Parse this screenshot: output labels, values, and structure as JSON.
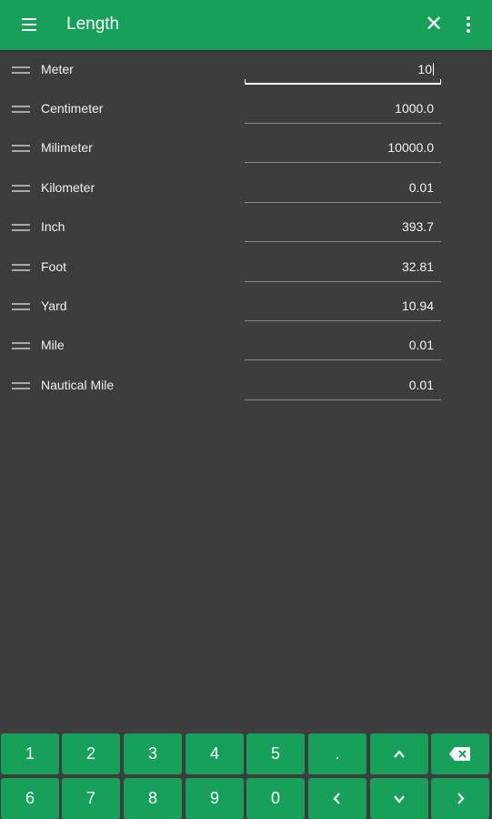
{
  "appbar": {
    "menu_icon": "hamburger-menu-icon",
    "title": "Length",
    "close_icon": "close-icon",
    "more_icon": "more-vert-icon",
    "color": "#16a05a"
  },
  "units": [
    {
      "label": "Meter",
      "value": "10"
    },
    {
      "label": "Centimeter",
      "value": "1000.0"
    },
    {
      "label": "Milimeter",
      "value": "10000.0"
    },
    {
      "label": "Kilometer",
      "value": "0.01"
    },
    {
      "label": "Inch",
      "value": "393.7"
    },
    {
      "label": "Foot",
      "value": "32.81"
    },
    {
      "label": "Yard",
      "value": "10.94"
    },
    {
      "label": "Mile",
      "value": "0.01"
    },
    {
      "label": "Nautical Mile",
      "value": "0.01"
    }
  ],
  "keypad": {
    "row1": [
      "1",
      "2",
      "3",
      "4",
      "5",
      "."
    ],
    "row2": [
      "6",
      "7",
      "8",
      "9",
      "0"
    ],
    "icons": [
      "arrow-up-icon",
      "backspace-icon",
      "arrow-left-icon",
      "arrow-down-icon",
      "arrow-right-icon"
    ]
  }
}
